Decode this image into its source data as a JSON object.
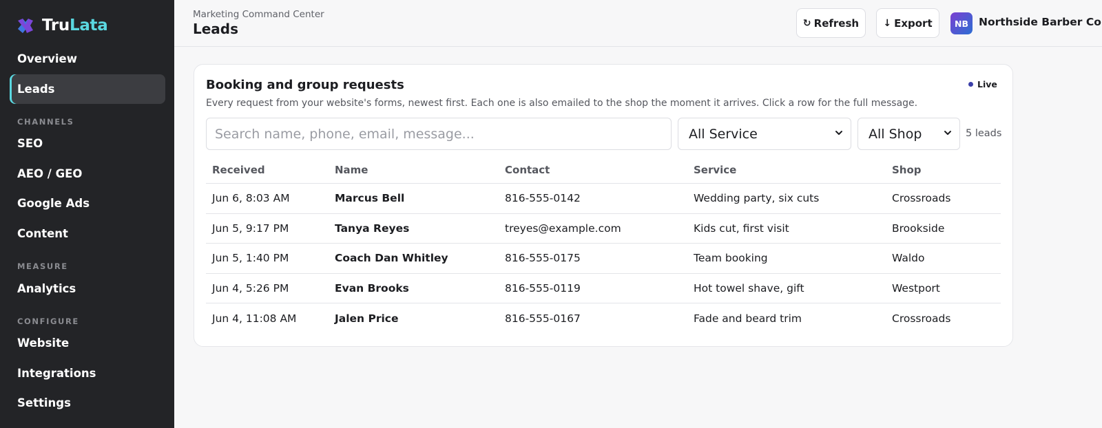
{
  "app": {
    "name_part1": "Tru",
    "name_part2": "Lata"
  },
  "sidebar": {
    "items": [
      {
        "label": "Overview"
      },
      {
        "label": "Leads",
        "active": true
      }
    ],
    "sections": [
      {
        "label": "CHANNELS",
        "items": [
          "SEO",
          "AEO / GEO",
          "Google Ads",
          "Content"
        ]
      },
      {
        "label": "MEASURE",
        "items": [
          "Analytics"
        ]
      },
      {
        "label": "CONFIGURE",
        "items": [
          "Website",
          "Integrations",
          "Settings"
        ]
      }
    ]
  },
  "header": {
    "breadcrumb": "Marketing Command Center",
    "title": "Leads",
    "refresh_label": "Refresh",
    "export_label": "Export",
    "avatar_initials": "NB",
    "org_name": "Northside Barber Co."
  },
  "card": {
    "title": "Booking and group requests",
    "subtitle": "Every request from your website's forms, newest first. Each one is also emailed to the shop the moment it arrives. Click a row for the full message.",
    "live_label": "Live",
    "search_placeholder": "Search name, phone, email, message...",
    "service_filter": "All Service",
    "shop_filter": "All Shop",
    "lead_count": "5 leads"
  },
  "table": {
    "headers": {
      "received": "Received",
      "name": "Name",
      "contact": "Contact",
      "service": "Service",
      "shop": "Shop"
    },
    "rows": [
      {
        "received": "Jun 6, 8:03 AM",
        "name": "Marcus Bell",
        "contact": "816-555-0142",
        "service": "Wedding party, six cuts",
        "shop": "Crossroads"
      },
      {
        "received": "Jun 5, 9:17 PM",
        "name": "Tanya Reyes",
        "contact": "treyes@example.com",
        "service": "Kids cut, first visit",
        "shop": "Brookside"
      },
      {
        "received": "Jun 5, 1:40 PM",
        "name": "Coach Dan Whitley",
        "contact": "816-555-0175",
        "service": "Team booking",
        "shop": "Waldo"
      },
      {
        "received": "Jun 4, 5:26 PM",
        "name": "Evan Brooks",
        "contact": "816-555-0119",
        "service": "Hot towel shave, gift",
        "shop": "Westport"
      },
      {
        "received": "Jun 4, 11:08 AM",
        "name": "Jalen Price",
        "contact": "816-555-0167",
        "service": "Fade and beard trim",
        "shop": "Crossroads"
      }
    ]
  },
  "colors": {
    "accent": "#5ad7e0",
    "sidebar_bg": "#232427",
    "live_dot": "#3b3fa8"
  },
  "icons": {
    "logo": "trulata-logo-icon",
    "refresh": "refresh-icon",
    "export": "download-arrow-icon",
    "select": "chevron-down-icon"
  }
}
